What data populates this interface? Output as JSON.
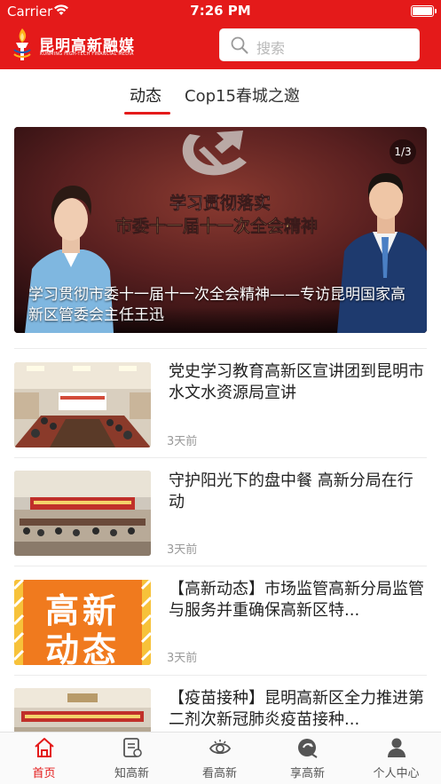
{
  "status_bar": {
    "carrier": "Carrier",
    "time": "7:26 PM"
  },
  "header": {
    "logo_cn": "昆明高新融媒",
    "logo_en": "KUNMING HIGH-TECH FINANCIAL MEDIA",
    "search_placeholder": "搜索"
  },
  "tabs": [
    {
      "label": "动态",
      "active": true
    },
    {
      "label": "Cop15春城之邀",
      "active": false
    }
  ],
  "banner": {
    "counter": "1/3",
    "headline_line1": "学习贯彻落实",
    "headline_line2": "市委十一届十一次全会精神",
    "caption": "学习贯彻市委十一届十一次全会精神——专访昆明国家高新区管委会主任王迅"
  },
  "news": [
    {
      "title": "党史学习教育高新区宣讲团到昆明市水文水资源局宣讲",
      "time": "3天前",
      "thumb": "meeting-room-photo"
    },
    {
      "title": "守护阳光下的盘中餐 高新分局在行动",
      "time": "3天前",
      "thumb": "conference-photo"
    },
    {
      "title": "【高新动态】市场监管高新分局监管与服务并重确保高新区特...",
      "time": "3天前",
      "thumb": "gaoxin-dongtai-graphic",
      "thumb_text_1": "高新",
      "thumb_text_2": "动态"
    },
    {
      "title": "【疫苗接种】昆明高新区全力推进第二剂次新冠肺炎疫苗接种...",
      "time": "",
      "thumb": "vaccine-meeting-photo"
    }
  ],
  "tabbar": [
    {
      "label": "首页",
      "icon": "home-icon",
      "active": true
    },
    {
      "label": "知高新",
      "icon": "document-icon",
      "active": false
    },
    {
      "label": "看高新",
      "icon": "eye-icon",
      "active": false
    },
    {
      "label": "享高新",
      "icon": "share-icon",
      "active": false
    },
    {
      "label": "个人中心",
      "icon": "person-icon",
      "active": false
    }
  ],
  "colors": {
    "brand": "#e41a1a",
    "accent_orange": "#f07a1e"
  }
}
